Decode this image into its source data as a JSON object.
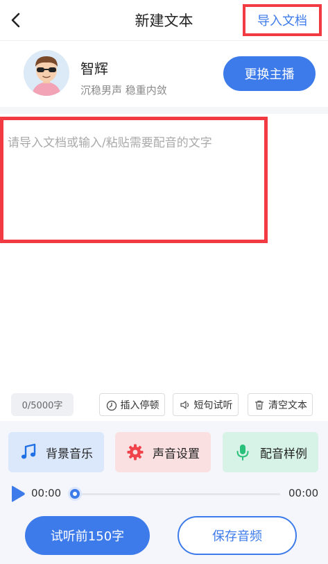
{
  "header": {
    "back_icon": "chevron-left-icon",
    "title": "新建文本",
    "import_label": "导入文档"
  },
  "voice": {
    "avatar_icon": "avatar-sunglasses",
    "name": "智辉",
    "description": "沉稳男声 稳重内敛",
    "change_label": "更换主播"
  },
  "editor": {
    "value": "",
    "placeholder": "请导入文档或输入/粘贴需要配音的文字"
  },
  "toolbar": {
    "counter": "0/5000字",
    "insert_pause": {
      "label": "插入停顿",
      "icon": "timer-icon"
    },
    "sentence_preview": {
      "label": "短句试听",
      "icon": "speaker-icon"
    },
    "clear_text": {
      "label": "清空文本",
      "icon": "trash-icon"
    }
  },
  "features": {
    "bgm": {
      "label": "背景音乐",
      "icon": "music-note-icon",
      "color": "#1f6fe5"
    },
    "voice_settings": {
      "label": "声音设置",
      "icon": "gear-icon",
      "color": "#f0434b"
    },
    "samples": {
      "label": "配音样例",
      "icon": "microphone-icon",
      "color": "#28c07a"
    }
  },
  "player": {
    "play_icon": "play-icon",
    "current_time": "00:00",
    "total_time": "00:00",
    "progress": 0
  },
  "actions": {
    "preview_label": "试听前150字",
    "save_label": "保存音频"
  },
  "colors": {
    "accent": "#3d7bea",
    "highlight_border": "#f23a43"
  }
}
